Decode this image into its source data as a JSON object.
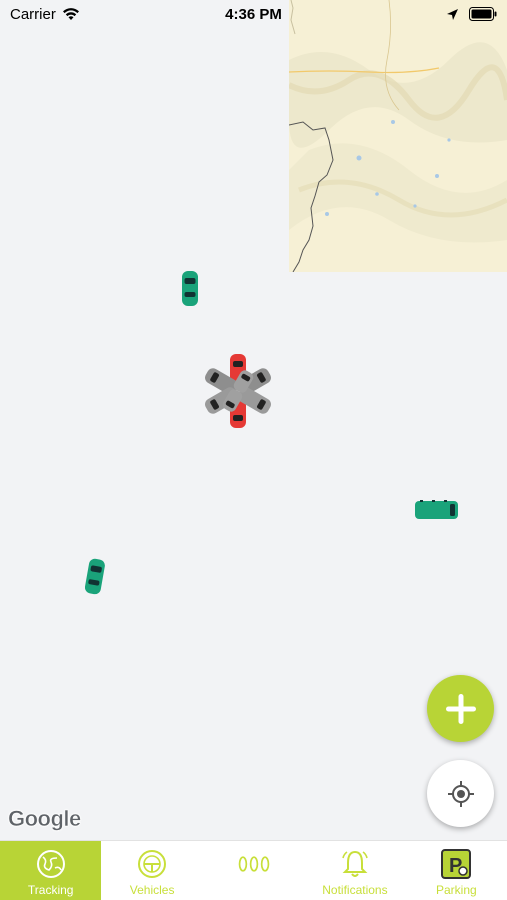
{
  "status_bar": {
    "carrier": "Carrier",
    "time": "4:36 PM"
  },
  "map": {
    "attribution": "Google"
  },
  "tabs": [
    {
      "label": "Tracking",
      "icon": "globe-icon",
      "active": true
    },
    {
      "label": "Vehicles",
      "icon": "steering-wheel-icon",
      "active": false
    },
    {
      "label": "",
      "icon": "tire-icon",
      "active": false
    },
    {
      "label": "Notifications",
      "icon": "bell-icon",
      "active": false
    },
    {
      "label": "Parking",
      "icon": "parking-icon",
      "active": false
    }
  ],
  "colors": {
    "accent": "#b8d436",
    "vehicle_online": "#1aa37a",
    "vehicle_alert": "#e53935",
    "vehicle_idle": "#8e8e8e"
  }
}
